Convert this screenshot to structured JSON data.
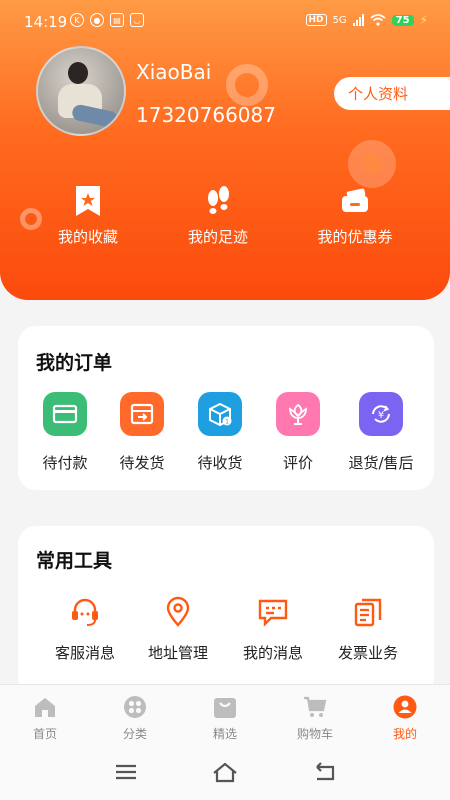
{
  "status_bar": {
    "time": "14:19",
    "left_icons": [
      "k-icon",
      "wechat-icon",
      "notification-icon",
      "app-icon"
    ],
    "right": {
      "hd": "HD",
      "network": "5G",
      "battery": "75"
    }
  },
  "profile": {
    "username": "XiaoBai",
    "phone": "17320766087",
    "profile_button": "个人资料"
  },
  "quick_links": [
    {
      "label": "我的收藏",
      "icon": "bookmark-star-icon"
    },
    {
      "label": "我的足迹",
      "icon": "footprints-icon"
    },
    {
      "label": "我的优惠券",
      "icon": "coupon-icon"
    }
  ],
  "orders": {
    "title": "我的订单",
    "items": [
      {
        "label": "待付款",
        "icon": "card-icon",
        "color": "#3cbd77"
      },
      {
        "label": "待发货",
        "icon": "ship-box-icon",
        "color": "#ff6a2a"
      },
      {
        "label": "待收货",
        "icon": "package-icon",
        "color": "#1f9fe0"
      },
      {
        "label": "评价",
        "icon": "flower-icon",
        "color": "#ff79b0"
      },
      {
        "label": "退货/售后",
        "icon": "refund-icon",
        "color": "#7b64f2"
      }
    ]
  },
  "tools": {
    "title": "常用工具",
    "items": [
      {
        "label": "客服消息",
        "icon": "headset-icon"
      },
      {
        "label": "地址管理",
        "icon": "location-pin-icon"
      },
      {
        "label": "我的消息",
        "icon": "message-icon"
      },
      {
        "label": "发票业务",
        "icon": "invoice-icon"
      }
    ]
  },
  "tabbar": [
    {
      "label": "首页",
      "icon": "home-icon",
      "active": false
    },
    {
      "label": "分类",
      "icon": "category-icon",
      "active": false
    },
    {
      "label": "精选",
      "icon": "shopping-bag-icon",
      "active": false
    },
    {
      "label": "购物车",
      "icon": "cart-icon",
      "active": false
    },
    {
      "label": "我的",
      "icon": "user-icon",
      "active": true
    }
  ],
  "colors": {
    "accent": "#ff5a14",
    "hero_top": "#ff9a45",
    "hero_bottom": "#fb4a0c"
  }
}
